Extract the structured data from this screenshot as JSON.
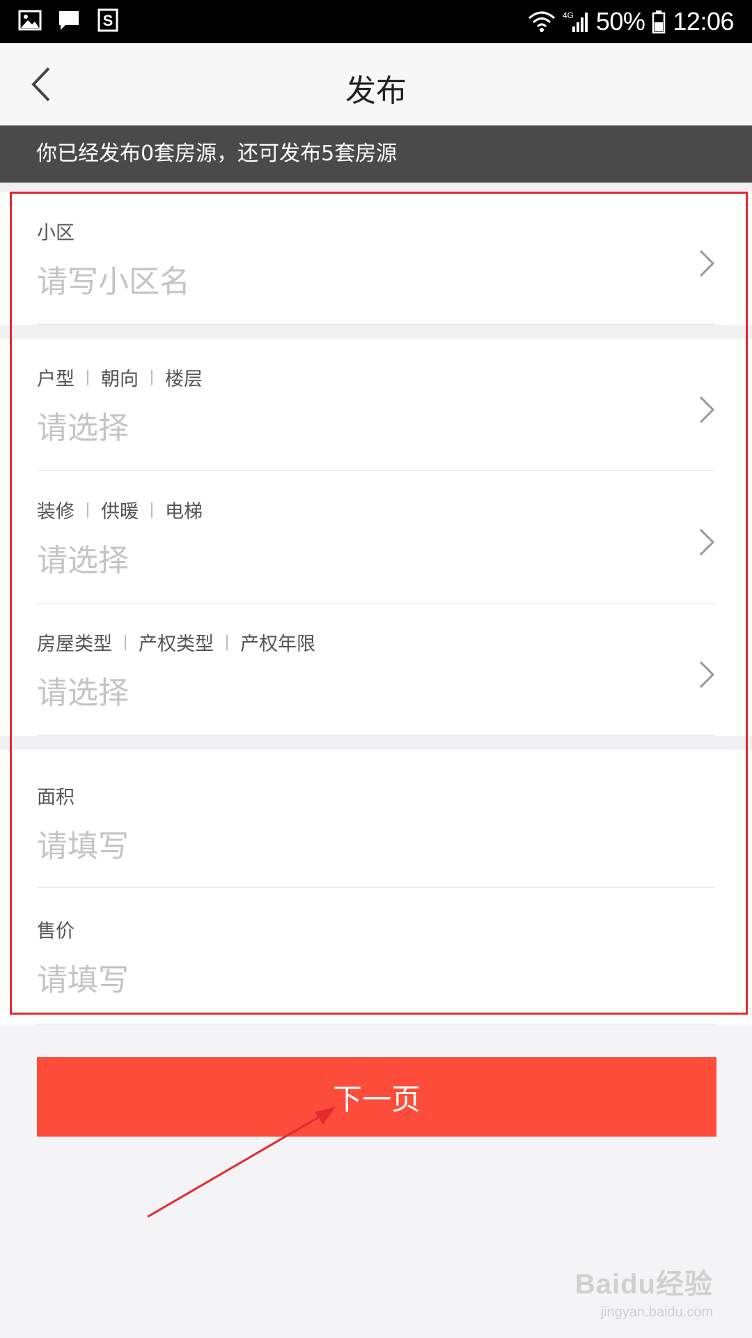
{
  "status_bar": {
    "battery": "50%",
    "time": "12:06",
    "network": "4G",
    "left_icons": [
      "image-icon",
      "message-icon",
      "s-app-icon"
    ]
  },
  "nav": {
    "title": "发布",
    "back_icon": "chevron-left-icon"
  },
  "notice": {
    "text": "你已经发布0套房源，还可发布5套房源"
  },
  "form": {
    "community": {
      "label": "小区",
      "placeholder": "请写小区名"
    },
    "layout": {
      "labels": [
        "户型",
        "朝向",
        "楼层"
      ],
      "placeholder": "请选择"
    },
    "decoration": {
      "labels": [
        "装修",
        "供暖",
        "电梯"
      ],
      "placeholder": "请选择"
    },
    "property": {
      "labels": [
        "房屋类型",
        "产权类型",
        "产权年限"
      ],
      "placeholder": "请选择"
    },
    "area": {
      "label": "面积",
      "placeholder": "请填写"
    },
    "price": {
      "label": "售价",
      "placeholder": "请填写"
    }
  },
  "next_button": {
    "label": "下一页"
  },
  "watermark": {
    "main": "Baidu经验",
    "sub": "jingyan.baidu.com"
  },
  "colors": {
    "accent": "#fd4c3a",
    "highlight": "#e5292c",
    "notice_bg": "#4a4a4a"
  }
}
